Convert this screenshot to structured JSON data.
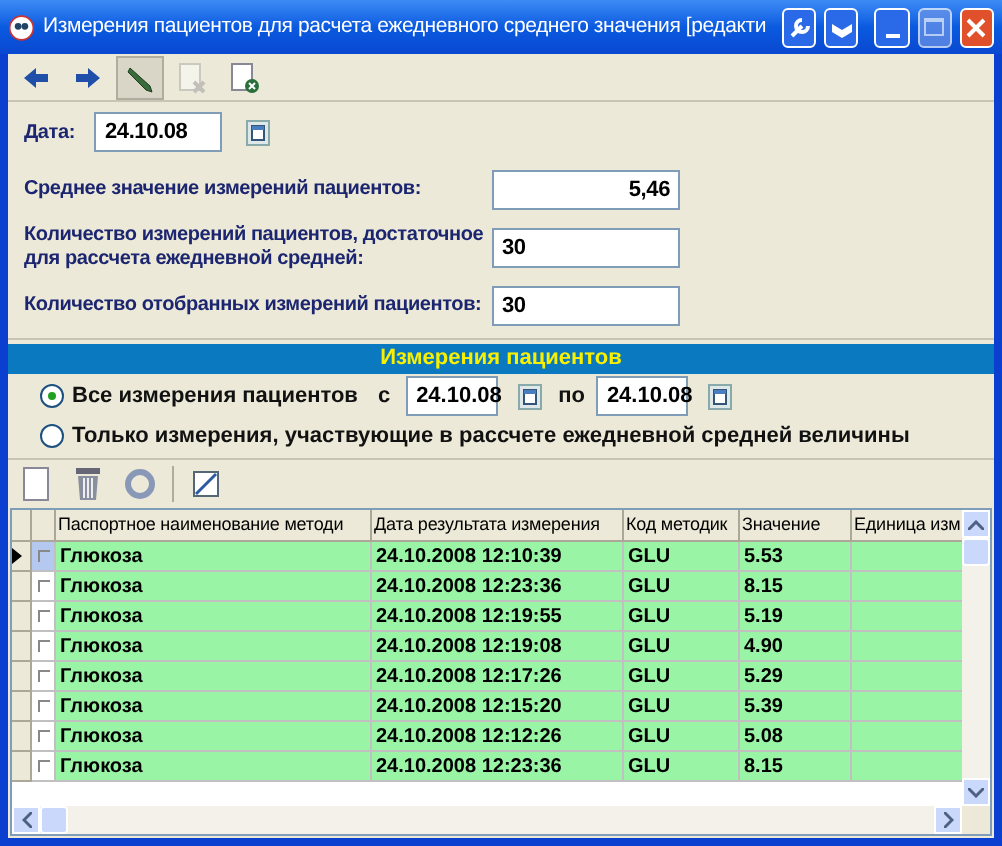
{
  "window": {
    "title": "Измерения пациентов для расчета ежедневного среднего значения [редакти"
  },
  "form": {
    "date_label": "Дата:",
    "date": "24.10.08",
    "fields": [
      {
        "label": "Среднее значение измерений пациентов:",
        "value": "5,46",
        "kind": "result"
      },
      {
        "label": "Количество измерений пациентов, достаточное для рассчета ежедневной средней:",
        "value": "30",
        "kind": "input"
      },
      {
        "label": "Количество отобранных измерений пациентов:",
        "value": "30",
        "kind": "input"
      }
    ]
  },
  "section": {
    "title": "Измерения пациентов"
  },
  "filters": [
    {
      "label": "Все измерения пациентов",
      "selected": true,
      "from_label": "с",
      "from": "24.10.08",
      "to_label": "по",
      "to": "24.10.08"
    },
    {
      "label": "Только измерения, участвующие в рассчете ежедневной средней величины",
      "selected": false
    }
  ],
  "table": {
    "columns": [
      "Паспортное наименование методи",
      "Дата результата измерения",
      "Код методик",
      "Значение",
      "Единица изм"
    ],
    "rows": [
      {
        "current": true,
        "checked": false,
        "cells": [
          "Глюкоза",
          "24.10.2008 12:10:39",
          "GLU",
          "5.53",
          ""
        ]
      },
      {
        "current": false,
        "checked": false,
        "cells": [
          "Глюкоза",
          "24.10.2008 12:23:36",
          "GLU",
          "8.15",
          ""
        ]
      },
      {
        "current": false,
        "checked": false,
        "cells": [
          "Глюкоза",
          "24.10.2008 12:19:55",
          "GLU",
          "5.19",
          ""
        ]
      },
      {
        "current": false,
        "checked": false,
        "cells": [
          "Глюкоза",
          "24.10.2008 12:19:08",
          "GLU",
          "4.90",
          ""
        ]
      },
      {
        "current": false,
        "checked": false,
        "cells": [
          "Глюкоза",
          "24.10.2008 12:17:26",
          "GLU",
          "5.29",
          ""
        ]
      },
      {
        "current": false,
        "checked": false,
        "cells": [
          "Глюкоза",
          "24.10.2008 12:15:20",
          "GLU",
          "5.39",
          ""
        ]
      },
      {
        "current": false,
        "checked": false,
        "cells": [
          "Глюкоза",
          "24.10.2008 12:12:26",
          "GLU",
          "5.08",
          ""
        ]
      },
      {
        "current": false,
        "checked": false,
        "cells": [
          "Глюкоза",
          "24.10.2008 12:23:36",
          "GLU",
          "8.15",
          ""
        ]
      }
    ]
  }
}
